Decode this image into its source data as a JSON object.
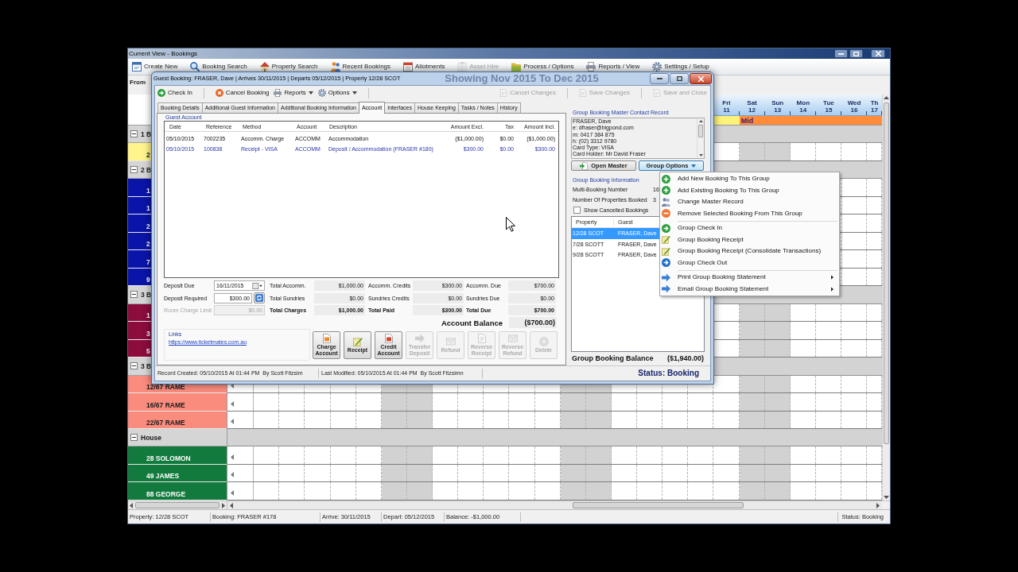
{
  "main_window": {
    "title": "Current View - Bookings"
  },
  "toolbar": [
    {
      "label": "Create New",
      "disabled": false
    },
    {
      "label": "Booking Search",
      "disabled": false
    },
    {
      "label": "Property Search",
      "disabled": false
    },
    {
      "label": "Recent Bookings",
      "disabled": false
    },
    {
      "label": "Allotments",
      "disabled": false
    },
    {
      "label": "Asset Hire",
      "disabled": true
    },
    {
      "label": "Process / Options",
      "disabled": false
    },
    {
      "label": "Reports / View",
      "disabled": false
    },
    {
      "label": "Settings / Setup",
      "disabled": false
    }
  ],
  "filter": {
    "label": "From"
  },
  "calendar": {
    "heading": "Showing Nov 2015 To Dec 2015",
    "days": [
      {
        "weekday": "Fri",
        "date": "11",
        "weekend": false,
        "season": {
          "color": "#fff27a"
        }
      },
      {
        "weekday": "Sat",
        "date": "12",
        "weekend": true,
        "season": {
          "label": "Mid",
          "color": "#ff8c3a"
        }
      },
      {
        "weekday": "Sun",
        "date": "13",
        "weekend": true,
        "season": {
          "color": "#ff8c3a"
        }
      },
      {
        "weekday": "Mon",
        "date": "14",
        "weekend": false,
        "season": {
          "color": "#ff8c3a"
        }
      },
      {
        "weekday": "Tue",
        "date": "15",
        "weekend": false,
        "season": {
          "color": "#ff8c3a"
        }
      },
      {
        "weekday": "Wed",
        "date": "16",
        "weekend": false,
        "season": {
          "color": "#ff8c3a"
        }
      },
      {
        "weekday": "Th",
        "date": "17",
        "weekend": false,
        "season": {
          "color": "#ff8c3a"
        }
      }
    ],
    "groups": [
      {
        "label": "1 B",
        "expanded": true,
        "color": "#fff38c",
        "rows": [
          {
            "name": "2"
          }
        ]
      },
      {
        "label": "2 B",
        "expanded": true,
        "color": "#0a14a8",
        "rows": [
          {
            "name": "1"
          },
          {
            "name": "1"
          },
          {
            "name": "2"
          },
          {
            "name": "2"
          },
          {
            "name": "7"
          },
          {
            "name": "9"
          }
        ]
      },
      {
        "label": "3 B",
        "expanded": true,
        "color": "#8c0c3c",
        "rows": [
          {
            "name": "1"
          },
          {
            "name": "3"
          },
          {
            "name": "5"
          }
        ]
      },
      {
        "label": "3 B",
        "expanded": true,
        "color": "#fa8c7e",
        "rows": [
          {
            "name": "12/67 RAME",
            "continues_left": true
          },
          {
            "name": "16/67 RAME",
            "continues_left": true
          },
          {
            "name": "22/67 RAME",
            "continues_left": true
          }
        ]
      },
      {
        "label": "House",
        "expanded": true,
        "color": "#137a3e",
        "rows": [
          {
            "name": "28 SOLOMON",
            "continues_left": true
          },
          {
            "name": "49 JAMES",
            "continues_left": true
          },
          {
            "name": "88 GEORGE",
            "continues_left": true
          }
        ]
      }
    ]
  },
  "dialog": {
    "title": "Guest Booking: FRASER, Dave | Arrives 30/11/2015 | Departs 05/12/2015 | Property 12/28 SCOT",
    "toolbar_left": [
      {
        "kind": "button",
        "label": "Check In",
        "disabled": false,
        "has_menu": false
      },
      {
        "kind": "separator"
      },
      {
        "kind": "button",
        "label": "Cancel Booking",
        "disabled": false,
        "has_menu": false
      },
      {
        "kind": "button",
        "label": "Reports",
        "disabled": false,
        "has_menu": true
      },
      {
        "kind": "button",
        "label": "Options",
        "disabled": false,
        "has_menu": true
      },
      {
        "kind": "separator"
      }
    ],
    "toolbar_right": [
      {
        "kind": "button",
        "label": "Cancel Changes",
        "disabled": true,
        "has_menu": false
      },
      {
        "kind": "separator"
      },
      {
        "kind": "button",
        "label": "Save Changes",
        "disabled": true,
        "has_menu": false
      },
      {
        "kind": "separator"
      },
      {
        "kind": "button",
        "label": "Save and Close",
        "disabled": true,
        "has_menu": false
      }
    ],
    "tabs": [
      {
        "label": "Booking Details",
        "selected": false
      },
      {
        "label": "Additional Guest Information",
        "selected": false
      },
      {
        "label": "Additional Booking Information",
        "selected": false
      },
      {
        "label": "Account",
        "selected": true
      },
      {
        "label": "Interfaces",
        "selected": false
      },
      {
        "label": "House Keeping",
        "selected": false
      },
      {
        "label": "Tasks / Notes",
        "selected": false
      },
      {
        "label": "History",
        "selected": false
      }
    ],
    "guest_account": {
      "title": "Guest Account",
      "columns": [
        "Date",
        "Reference",
        "Method",
        "Account",
        "Description",
        "Amount Excl.",
        "Tax",
        "Amount Incl."
      ],
      "rows": [
        {
          "kind": "charge",
          "cells": [
            "05/10/2015",
            "7002235",
            "Accomm. Charge",
            "ACCOMM",
            "Accommodation",
            "($1,000.00)",
            "$0.00",
            "($1,000.00)"
          ]
        },
        {
          "kind": "receipt",
          "cells": [
            "05/10/2015",
            "100838",
            "Receipt - VISA",
            "ACCOMM",
            "Deposit / Accommodation (FRASER #180)",
            "$300.00",
            "$0.00",
            "$300.00"
          ]
        }
      ]
    },
    "summary": {
      "fields": [
        {
          "kind": "date",
          "label": "Deposit Due",
          "value": "16/11/2015",
          "disabled": false
        },
        {
          "kind": "recalc",
          "label": "Deposit Required",
          "value": "$300.00",
          "disabled": false
        },
        {
          "kind": "plain",
          "label": "Room Charge Limit",
          "value": "$0.00",
          "disabled": true
        }
      ],
      "totals": [
        {
          "label": "Total Accomm.",
          "value": "$1,000.00",
          "bold": false
        },
        {
          "label": "Accomm. Credits",
          "value": "$300.00",
          "bold": false
        },
        {
          "label": "Accomm. Due",
          "value": "$700.00",
          "bold": false
        },
        {
          "label": "Total Sundries",
          "value": "$0.00",
          "bold": false
        },
        {
          "label": "Sundries Credits",
          "value": "$0.00",
          "bold": false
        },
        {
          "label": "Sundries Due",
          "value": "$0.00",
          "bold": false
        },
        {
          "label": "Total Charges",
          "value": "$1,000.00",
          "bold": true
        },
        {
          "label": "Total Paid",
          "value": "$300.00",
          "bold": true
        },
        {
          "label": "Total Due",
          "value": "$700.00",
          "bold": true
        }
      ],
      "balance": {
        "label": "Account Balance",
        "value": "($700.00)"
      }
    },
    "links": {
      "title": "Links",
      "url": "https://www.ticketmates.com.au"
    },
    "actions": [
      {
        "label": "Charge Account",
        "disabled": false
      },
      {
        "label": "Receipt",
        "disabled": false
      },
      {
        "label": "Credit Account",
        "disabled": false
      },
      {
        "label": "Transfer Deposit",
        "disabled": true
      },
      {
        "label": "Refund",
        "disabled": true
      },
      {
        "label": "Reverse Receipt",
        "disabled": true
      },
      {
        "label": "Reverse Refund",
        "disabled": true
      },
      {
        "label": "Delete",
        "disabled": true
      }
    ],
    "group": {
      "contact_title": "Group Booking Master Contact Record",
      "contact_lines": [
        "FRASER, Dave",
        "e: dfraser@bigpond.com",
        "m: 0417 384 875",
        "h: (02) 3312 9780",
        "Card Type: VISA",
        "Card Holder: Mr David Fraser"
      ],
      "buttons": [
        {
          "label": "Open Master",
          "has_menu": false,
          "pressed": false
        },
        {
          "label": "Group Options",
          "has_menu": true,
          "pressed": true
        }
      ],
      "info_title": "Group Booking Information",
      "fields": [
        {
          "label": "Multi-Booking Number",
          "value": "16"
        },
        {
          "label": "Number Of Properties Booked",
          "value": "3"
        }
      ],
      "show_cancelled": {
        "label": "Show Cancelled Bookings",
        "checked": false
      },
      "columns": [
        "Property",
        "Guest"
      ],
      "bookings": [
        {
          "property": "12/28 SCOT",
          "guest": "FRASER, Dave",
          "selected": true
        },
        {
          "property": "7/28 SCOTT",
          "guest": "FRASER, Dave",
          "selected": false
        },
        {
          "property": "9/28 SCOTT",
          "guest": "FRASER, Dave",
          "selected": false
        }
      ],
      "balance": {
        "label": "Group Booking Balance",
        "value": "($1,940.00)"
      }
    },
    "record_info": [
      "Record Created: 05/10/2015 At 01:44 PM  By Scott Fitzsim",
      "Last Modified: 05/10/2015 At 01:44 PM  By Scott Fitzsimn"
    ],
    "status": "Status: Booking"
  },
  "context_menu": [
    {
      "kind": "item",
      "label": "Add New Booking To This Group",
      "submenu": false
    },
    {
      "kind": "item",
      "label": "Add Existing Booking To This Group",
      "submenu": false
    },
    {
      "kind": "item",
      "label": "Change Master Record",
      "submenu": false
    },
    {
      "kind": "item",
      "label": "Remove Selected Booking From This Group",
      "submenu": false
    },
    {
      "kind": "separator"
    },
    {
      "kind": "item",
      "label": "Group Check In",
      "submenu": false
    },
    {
      "kind": "item",
      "label": "Group Booking Receipt",
      "submenu": false
    },
    {
      "kind": "item",
      "label": "Group Booking Receipt (Consolidate Transactions)",
      "submenu": false
    },
    {
      "kind": "item",
      "label": "Group Check Out",
      "submenu": false
    },
    {
      "kind": "separator"
    },
    {
      "kind": "item",
      "label": "Print Group Booking Statement",
      "submenu": true
    },
    {
      "kind": "item",
      "label": "Email Group Booking Statement",
      "submenu": true
    }
  ],
  "status_bar": {
    "items": [
      "Property: 12/28 SCOT",
      "Booking: FRASER #178",
      "Arrive: 30/11/2015",
      "Depart: 05/12/2015",
      "Balance: -$1,000.00"
    ],
    "status": "Status: Booking"
  }
}
